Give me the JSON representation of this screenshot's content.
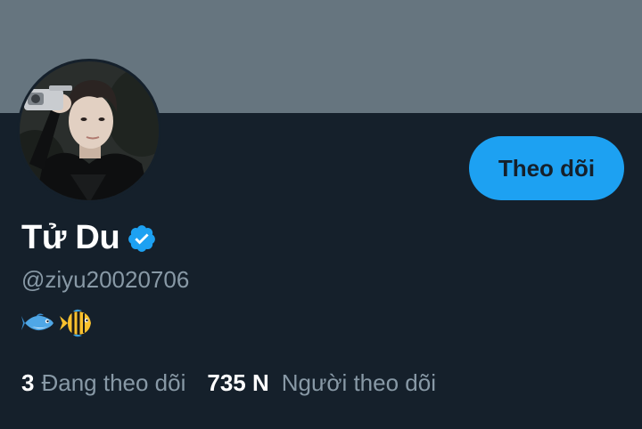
{
  "profile": {
    "display_name": "Tử Du",
    "handle": "@ziyu20020706",
    "verified": true,
    "avatar_alt": "profile photo",
    "bio_icons": [
      "fish-icon",
      "tropical-fish-icon"
    ]
  },
  "actions": {
    "follow_label": "Theo dõi"
  },
  "stats": {
    "following_count": "3",
    "following_label": "Đang theo dõi",
    "followers_count": "735 N",
    "followers_label": "Người theo dõi"
  },
  "colors": {
    "background": "#15202b",
    "banner": "#66757f",
    "accent": "#1da1f2",
    "muted_text": "#8899a6",
    "primary_text": "#ffffff"
  }
}
